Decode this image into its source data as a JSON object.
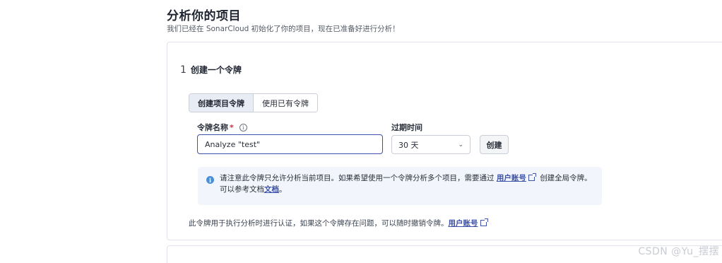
{
  "header": {
    "title": "分析你的项目",
    "subtitle": "我们已经在 SonarCloud 初始化了你的项目，现在已准备好进行分析！"
  },
  "step": {
    "number": "1",
    "title": "创建一个令牌"
  },
  "tabs": [
    {
      "label": "创建项目令牌",
      "active": true
    },
    {
      "label": "使用已有令牌",
      "active": false
    }
  ],
  "token_name": {
    "label": "令牌名称",
    "required_mark": "*",
    "value": "Analyze \"test\""
  },
  "expiry": {
    "label": "过期时间",
    "selected": "30 天"
  },
  "create_button": "创建",
  "notice": {
    "text_1": "请注意此令牌只允许分析当前项目。如果希望使用一个令牌分析多个项目，需要通过",
    "link_1": "用户账号",
    "text_2": "创建全局令牌。可以参考文档",
    "link_2": "文档",
    "text_3": "。"
  },
  "footer": {
    "text": "此令牌用于执行分析时进行认证，如果这个令牌存在问题，可以随时撤销令牌。",
    "link": "用户账号"
  },
  "watermark": "CSDN @Yu_摆摆"
}
